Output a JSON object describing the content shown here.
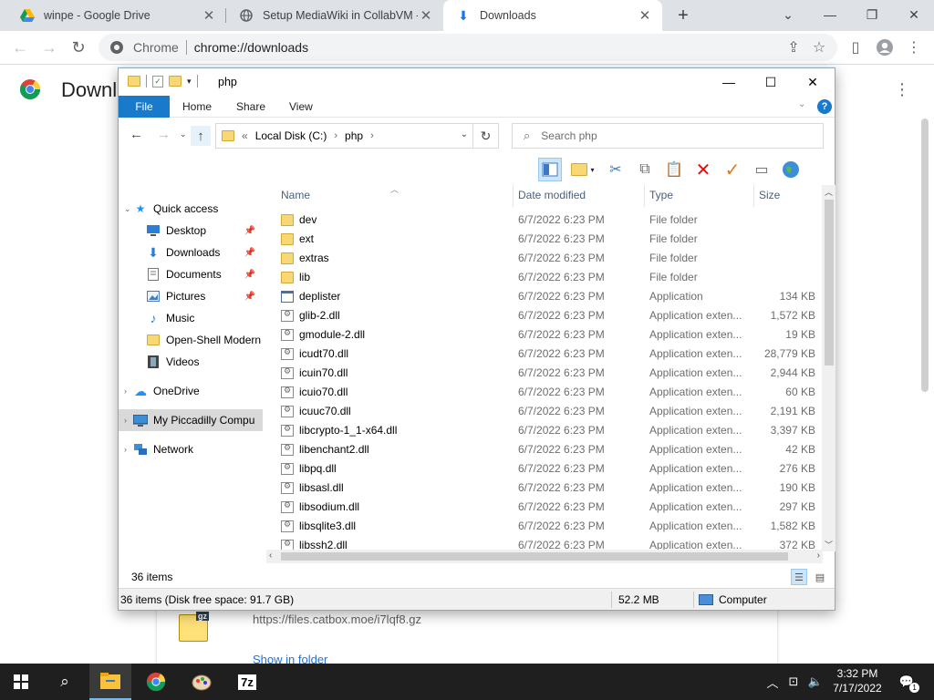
{
  "chrome": {
    "tabs": [
      {
        "title": "winpe - Google Drive",
        "active": false
      },
      {
        "title": "Setup MediaWiki in CollabVM - G",
        "active": false
      },
      {
        "title": "Downloads",
        "active": true
      }
    ],
    "omnibox": {
      "site": "Chrome",
      "url": "chrome://downloads"
    }
  },
  "downloads_page": {
    "title": "Downloads",
    "file_url": "https://files.catbox.moe/i7lqf8.gz",
    "show_in_folder": "Show in folder",
    "file_badge": "gz"
  },
  "explorer": {
    "window_title": "php",
    "ribbon_tabs": [
      "File",
      "Home",
      "Share",
      "View"
    ],
    "breadcrumb": [
      "Local Disk (C:)",
      "php"
    ],
    "breadcrumb_prefix": "«",
    "search_placeholder": "Search php",
    "nav": [
      {
        "label": "Quick access",
        "icon": "star-icon",
        "level": 0,
        "arrow": "expanded"
      },
      {
        "label": "Desktop",
        "icon": "desktop-icon",
        "level": 1,
        "pinned": true
      },
      {
        "label": "Downloads",
        "icon": "download-arrow-icon",
        "level": 1,
        "pinned": true
      },
      {
        "label": "Documents",
        "icon": "document-icon",
        "level": 1,
        "pinned": true
      },
      {
        "label": "Pictures",
        "icon": "pictures-icon",
        "level": 1,
        "pinned": true
      },
      {
        "label": "Music",
        "icon": "music-note-icon",
        "level": 1
      },
      {
        "label": "Open-Shell Modern",
        "icon": "folder-icon",
        "level": 1
      },
      {
        "label": "Videos",
        "icon": "film-icon",
        "level": 1
      },
      {
        "label": "OneDrive",
        "icon": "cloud-icon",
        "level": 0,
        "arrow": "collapsed"
      },
      {
        "label": "My Piccadilly Compu",
        "icon": "computer-icon",
        "level": 0,
        "arrow": "collapsed",
        "selected": true
      },
      {
        "label": "Network",
        "icon": "network-icon",
        "level": 0,
        "arrow": "collapsed"
      }
    ],
    "columns": [
      "Name",
      "Date modified",
      "Type",
      "Size"
    ],
    "files": [
      {
        "name": "dev",
        "date": "6/7/2022 6:23 PM",
        "type": "File folder",
        "size": "",
        "kind": "folder"
      },
      {
        "name": "ext",
        "date": "6/7/2022 6:23 PM",
        "type": "File folder",
        "size": "",
        "kind": "folder"
      },
      {
        "name": "extras",
        "date": "6/7/2022 6:23 PM",
        "type": "File folder",
        "size": "",
        "kind": "folder"
      },
      {
        "name": "lib",
        "date": "6/7/2022 6:23 PM",
        "type": "File folder",
        "size": "",
        "kind": "folder"
      },
      {
        "name": "deplister",
        "date": "6/7/2022 6:23 PM",
        "type": "Application",
        "size": "134 KB",
        "kind": "app"
      },
      {
        "name": "glib-2.dll",
        "date": "6/7/2022 6:23 PM",
        "type": "Application exten...",
        "size": "1,572 KB",
        "kind": "dll"
      },
      {
        "name": "gmodule-2.dll",
        "date": "6/7/2022 6:23 PM",
        "type": "Application exten...",
        "size": "19 KB",
        "kind": "dll"
      },
      {
        "name": "icudt70.dll",
        "date": "6/7/2022 6:23 PM",
        "type": "Application exten...",
        "size": "28,779 KB",
        "kind": "dll"
      },
      {
        "name": "icuin70.dll",
        "date": "6/7/2022 6:23 PM",
        "type": "Application exten...",
        "size": "2,944 KB",
        "kind": "dll"
      },
      {
        "name": "icuio70.dll",
        "date": "6/7/2022 6:23 PM",
        "type": "Application exten...",
        "size": "60 KB",
        "kind": "dll"
      },
      {
        "name": "icuuc70.dll",
        "date": "6/7/2022 6:23 PM",
        "type": "Application exten...",
        "size": "2,191 KB",
        "kind": "dll"
      },
      {
        "name": "libcrypto-1_1-x64.dll",
        "date": "6/7/2022 6:23 PM",
        "type": "Application exten...",
        "size": "3,397 KB",
        "kind": "dll"
      },
      {
        "name": "libenchant2.dll",
        "date": "6/7/2022 6:23 PM",
        "type": "Application exten...",
        "size": "42 KB",
        "kind": "dll"
      },
      {
        "name": "libpq.dll",
        "date": "6/7/2022 6:23 PM",
        "type": "Application exten...",
        "size": "276 KB",
        "kind": "dll"
      },
      {
        "name": "libsasl.dll",
        "date": "6/7/2022 6:23 PM",
        "type": "Application exten...",
        "size": "190 KB",
        "kind": "dll"
      },
      {
        "name": "libsodium.dll",
        "date": "6/7/2022 6:23 PM",
        "type": "Application exten...",
        "size": "297 KB",
        "kind": "dll"
      },
      {
        "name": "libsqlite3.dll",
        "date": "6/7/2022 6:23 PM",
        "type": "Application exten...",
        "size": "1,582 KB",
        "kind": "dll"
      },
      {
        "name": "libssh2.dll",
        "date": "6/7/2022 6:23 PM",
        "type": "Application exten...",
        "size": "372 KB",
        "kind": "dll"
      }
    ],
    "item_count": "36 items",
    "status_detail": "36 items (Disk free space: 91.7 GB)",
    "status_size": "52.2 MB",
    "status_location": "Computer"
  },
  "taskbar": {
    "time": "3:32 PM",
    "date": "7/17/2022",
    "apps": [
      "start-icon",
      "search-icon",
      "file-explorer-icon",
      "chrome-icon",
      "paint-icon",
      "7zip-icon"
    ],
    "seven_zip_label": "7z",
    "notification_count": "1"
  }
}
